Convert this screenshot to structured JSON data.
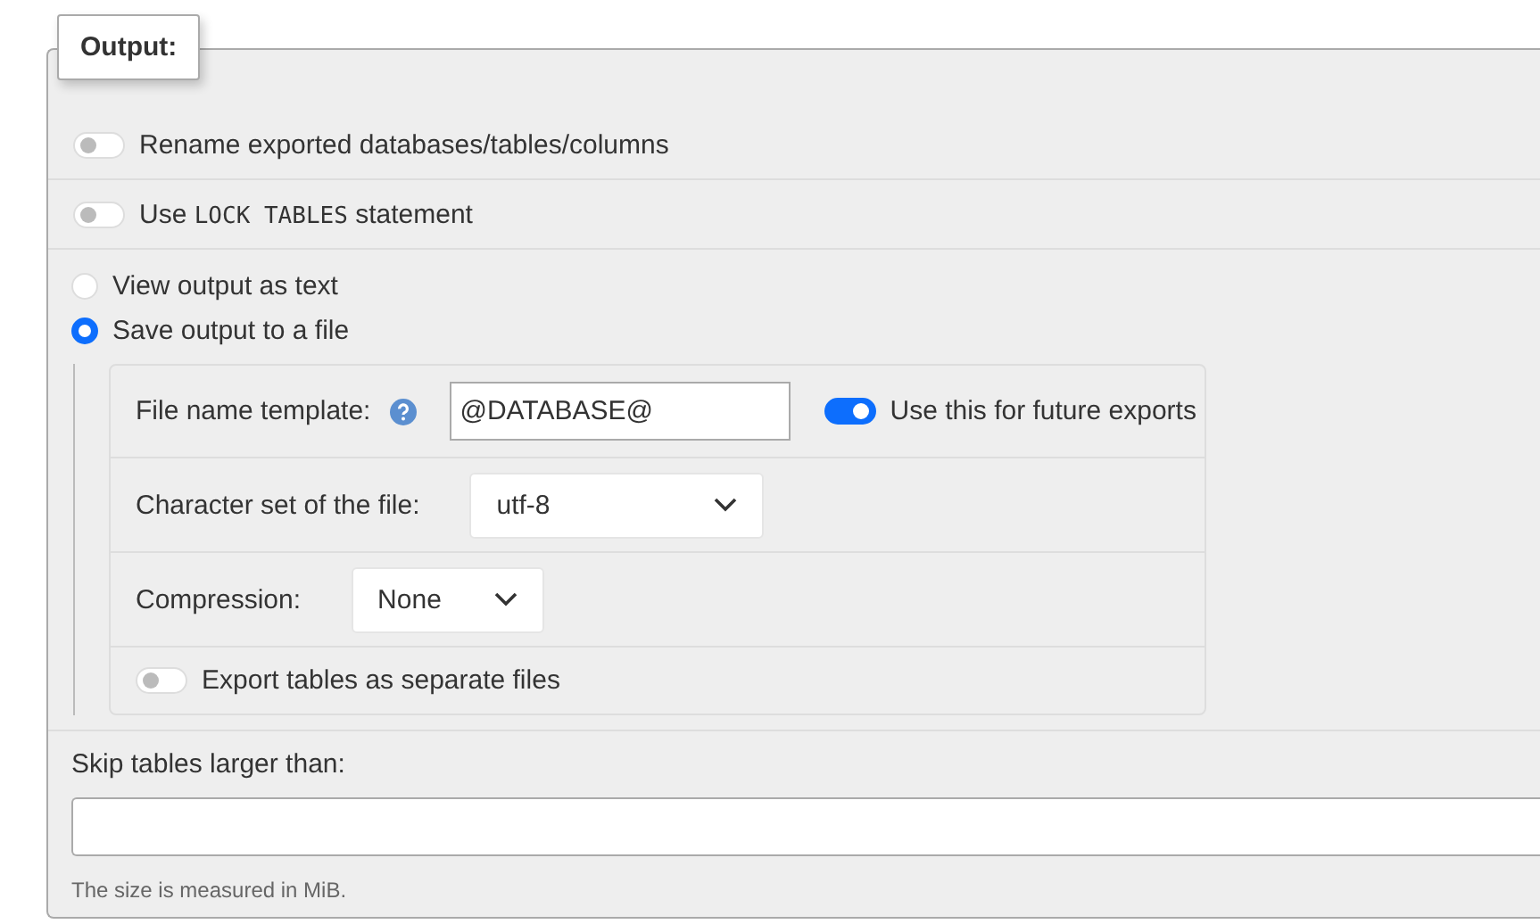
{
  "legend": "Output:",
  "options": [
    {
      "kind": "toggle",
      "label": [
        {
          "text": "Rename exported databases/tables/columns"
        }
      ],
      "on": false
    },
    {
      "kind": "toggle",
      "label": [
        {
          "text": "Use "
        },
        {
          "text": "LOCK TABLES",
          "kind": "code"
        },
        {
          "text": " statement"
        }
      ],
      "on": false
    }
  ],
  "output_modes": [
    {
      "label": "View output as text",
      "selected": false
    },
    {
      "label": "Save output to a file",
      "selected": true
    }
  ],
  "file_settings": [
    {
      "kind": "text_field",
      "label": "File name template:",
      "value": "@DATABASE@",
      "toggle": {
        "label": "Use this for future exports",
        "on": true
      }
    },
    {
      "kind": "select",
      "label": "Character set of the file:",
      "value": "utf-8"
    },
    {
      "kind": "select",
      "label": "Compression:",
      "value": "None"
    },
    {
      "kind": "toggle",
      "label": "Export tables as separate files",
      "on": false
    }
  ],
  "skip_tables": {
    "label": "Skip tables larger than:",
    "hint": "The size is measured in MiB."
  }
}
